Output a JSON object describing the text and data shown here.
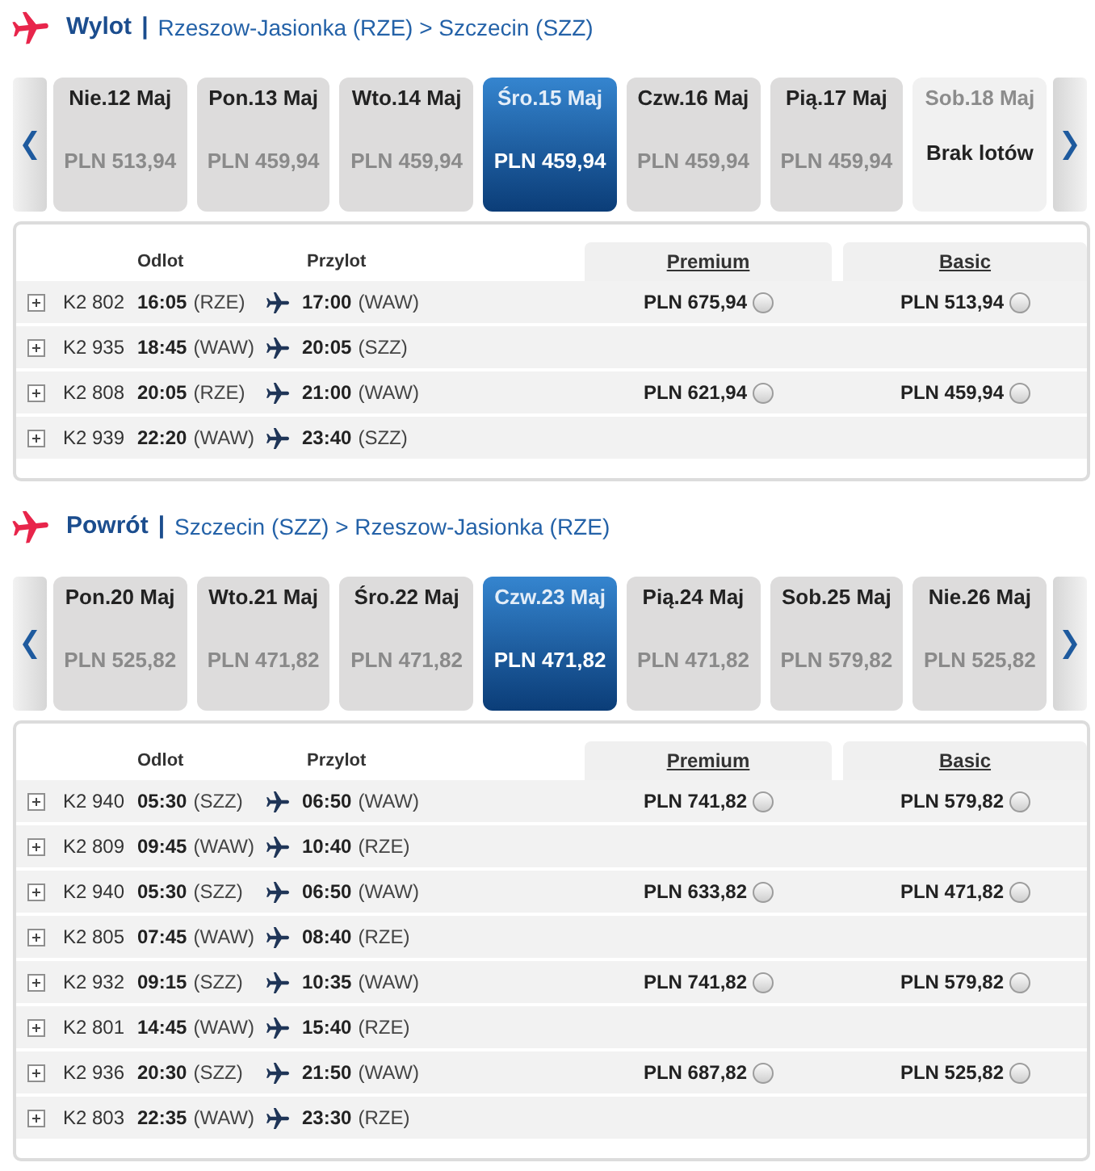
{
  "sections": [
    {
      "title": "Wylot",
      "separator": "|",
      "route": "Rzeszow-Jasionka (RZE) > Szczecin (SZZ)",
      "dates": [
        {
          "day": "Nie.12 Maj",
          "fare": "PLN 513,94",
          "selected": false,
          "available": true
        },
        {
          "day": "Pon.13 Maj",
          "fare": "PLN 459,94",
          "selected": false,
          "available": true
        },
        {
          "day": "Wto.14 Maj",
          "fare": "PLN 459,94",
          "selected": false,
          "available": true
        },
        {
          "day": "Śro.15 Maj",
          "fare": "PLN 459,94",
          "selected": true,
          "available": true
        },
        {
          "day": "Czw.16 Maj",
          "fare": "PLN 459,94",
          "selected": false,
          "available": true
        },
        {
          "day": "Pią.17 Maj",
          "fare": "PLN 459,94",
          "selected": false,
          "available": true
        },
        {
          "day": "Sob.18 Maj",
          "fare": "Brak lotów",
          "selected": false,
          "available": false
        }
      ],
      "columns": {
        "departure": "Odlot",
        "arrival": "Przylot",
        "fare_classes": [
          "Premium",
          "Basic"
        ]
      },
      "flights": [
        {
          "number": "K2 802",
          "departure_time": "16:05",
          "departure_airport": "(RZE)",
          "arrival_time": "17:00",
          "arrival_airport": "(WAW)",
          "expanded": false,
          "fares": [
            {
              "price": "PLN 675,94",
              "selected": false
            },
            {
              "price": "PLN 513,94",
              "selected": false
            }
          ]
        },
        {
          "number": "K2 935",
          "departure_time": "18:45",
          "departure_airport": "(WAW)",
          "arrival_time": "20:05",
          "arrival_airport": "(SZZ)",
          "expanded": false
        },
        {
          "number": "K2 808",
          "departure_time": "20:05",
          "departure_airport": "(RZE)",
          "arrival_time": "21:00",
          "arrival_airport": "(WAW)",
          "expanded": false,
          "fares": [
            {
              "price": "PLN 621,94",
              "selected": false
            },
            {
              "price": "PLN 459,94",
              "selected": false
            }
          ]
        },
        {
          "number": "K2 939",
          "departure_time": "22:20",
          "departure_airport": "(WAW)",
          "arrival_time": "23:40",
          "arrival_airport": "(SZZ)",
          "expanded": false
        }
      ]
    },
    {
      "title": "Powrót",
      "separator": "|",
      "route": "Szczecin (SZZ) > Rzeszow-Jasionka (RZE)",
      "dates": [
        {
          "day": "Pon.20 Maj",
          "fare": "PLN 525,82",
          "selected": false,
          "available": true
        },
        {
          "day": "Wto.21 Maj",
          "fare": "PLN 471,82",
          "selected": false,
          "available": true
        },
        {
          "day": "Śro.22 Maj",
          "fare": "PLN 471,82",
          "selected": false,
          "available": true
        },
        {
          "day": "Czw.23 Maj",
          "fare": "PLN 471,82",
          "selected": true,
          "available": true
        },
        {
          "day": "Pią.24 Maj",
          "fare": "PLN 471,82",
          "selected": false,
          "available": true
        },
        {
          "day": "Sob.25 Maj",
          "fare": "PLN 579,82",
          "selected": false,
          "available": true
        },
        {
          "day": "Nie.26 Maj",
          "fare": "PLN 525,82",
          "selected": false,
          "available": true
        }
      ],
      "columns": {
        "departure": "Odlot",
        "arrival": "Przylot",
        "fare_classes": [
          "Premium",
          "Basic"
        ]
      },
      "flights": [
        {
          "number": "K2 940",
          "departure_time": "05:30",
          "departure_airport": "(SZZ)",
          "arrival_time": "06:50",
          "arrival_airport": "(WAW)",
          "expanded": false,
          "fares": [
            {
              "price": "PLN 741,82",
              "selected": false
            },
            {
              "price": "PLN 579,82",
              "selected": false
            }
          ]
        },
        {
          "number": "K2 809",
          "departure_time": "09:45",
          "departure_airport": "(WAW)",
          "arrival_time": "10:40",
          "arrival_airport": "(RZE)",
          "expanded": false
        },
        {
          "number": "K2 940",
          "departure_time": "05:30",
          "departure_airport": "(SZZ)",
          "arrival_time": "06:50",
          "arrival_airport": "(WAW)",
          "expanded": false,
          "fares": [
            {
              "price": "PLN 633,82",
              "selected": false
            },
            {
              "price": "PLN 471,82",
              "selected": false
            }
          ]
        },
        {
          "number": "K2 805",
          "departure_time": "07:45",
          "departure_airport": "(WAW)",
          "arrival_time": "08:40",
          "arrival_airport": "(RZE)",
          "expanded": false
        },
        {
          "number": "K2 932",
          "departure_time": "09:15",
          "departure_airport": "(SZZ)",
          "arrival_time": "10:35",
          "arrival_airport": "(WAW)",
          "expanded": false,
          "fares": [
            {
              "price": "PLN 741,82",
              "selected": false
            },
            {
              "price": "PLN 579,82",
              "selected": false
            }
          ]
        },
        {
          "number": "K2 801",
          "departure_time": "14:45",
          "departure_airport": "(WAW)",
          "arrival_time": "15:40",
          "arrival_airport": "(RZE)",
          "expanded": false
        },
        {
          "number": "K2 936",
          "departure_time": "20:30",
          "departure_airport": "(SZZ)",
          "arrival_time": "21:50",
          "arrival_airport": "(WAW)",
          "expanded": false,
          "fares": [
            {
              "price": "PLN 687,82",
              "selected": false
            },
            {
              "price": "PLN 525,82",
              "selected": false
            }
          ]
        },
        {
          "number": "K2 803",
          "departure_time": "22:35",
          "departure_airport": "(WAW)",
          "arrival_time": "23:30",
          "arrival_airport": "(RZE)",
          "expanded": false
        }
      ]
    }
  ]
}
